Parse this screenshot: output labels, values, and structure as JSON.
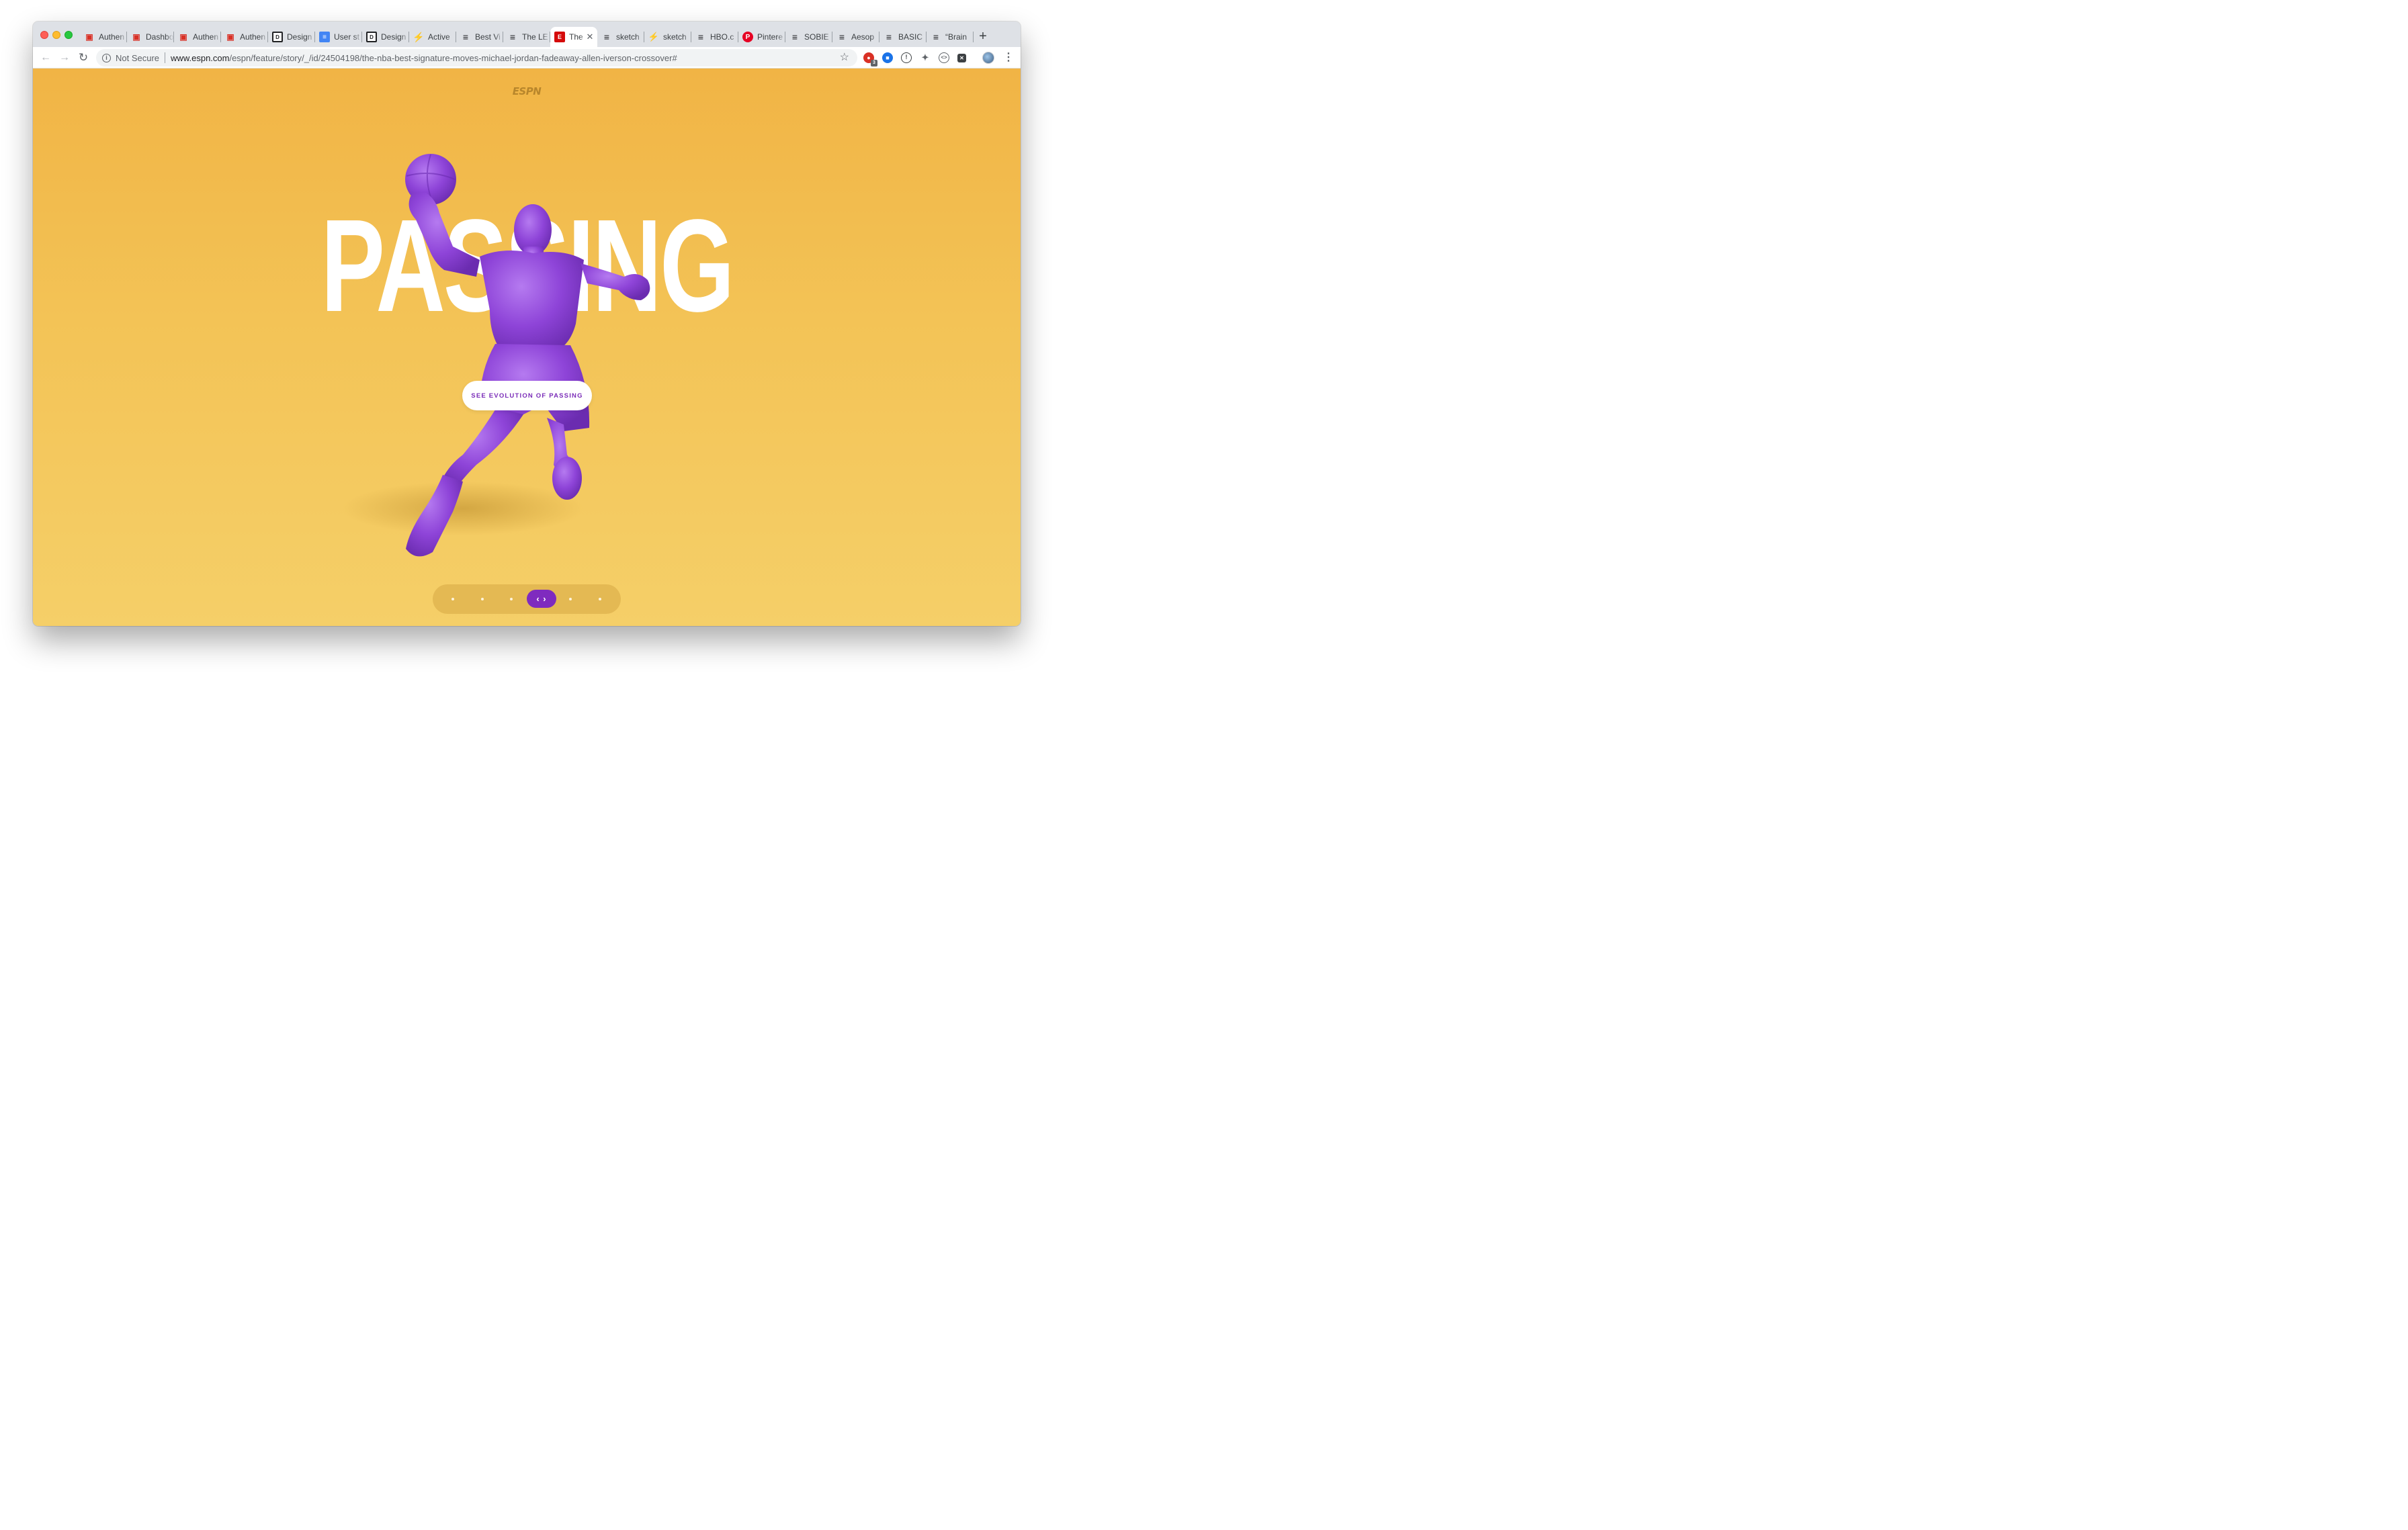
{
  "browser": {
    "tabs": [
      {
        "label": "Authen",
        "icon": "bus-icon",
        "glyph": "▣"
      },
      {
        "label": "Dashbo",
        "icon": "bus-icon",
        "glyph": "▣"
      },
      {
        "label": "Authen",
        "icon": "bus-icon",
        "glyph": "▣"
      },
      {
        "label": "Authen",
        "icon": "bus-icon",
        "glyph": "▣"
      },
      {
        "label": "Design",
        "icon": "design-icon",
        "glyph": "D"
      },
      {
        "label": "User st",
        "icon": "docs-icon",
        "glyph": "≡"
      },
      {
        "label": "Design",
        "icon": "design-icon",
        "glyph": "D"
      },
      {
        "label": "Active",
        "icon": "active-icon",
        "glyph": "⚡"
      },
      {
        "label": "Best Vi",
        "icon": "stack-icon",
        "glyph": "≡"
      },
      {
        "label": "The LE",
        "icon": "stack-icon",
        "glyph": "≡"
      },
      {
        "label": "The",
        "icon": "espn-icon",
        "glyph": "E",
        "active": true
      },
      {
        "label": "sketch",
        "icon": "stack-icon",
        "glyph": "≡"
      },
      {
        "label": "sketch",
        "icon": "sketch-icon",
        "glyph": "⚡"
      },
      {
        "label": "HBO.c",
        "icon": "stack-icon",
        "glyph": "≡"
      },
      {
        "label": "Pintere",
        "icon": "pinterest-icon",
        "glyph": "P"
      },
      {
        "label": "SOBIE",
        "icon": "stack-icon",
        "glyph": "≡"
      },
      {
        "label": "Aesop",
        "icon": "stack-icon",
        "glyph": "≡"
      },
      {
        "label": "BASIC",
        "icon": "stack-icon",
        "glyph": "≡"
      },
      {
        "label": "“Brain",
        "icon": "stack-icon",
        "glyph": "≡"
      }
    ],
    "active_tab_close": "✕",
    "new_tab": "+",
    "security_label": "Not Secure",
    "url_host": "www.espn.com",
    "url_path": "/espn/feature/story/_/id/24504198/the-nba-best-signature-moves-michael-jordan-fadeaway-allen-iverson-crossover#",
    "extension_badge": "3"
  },
  "page": {
    "logo": "ESPN",
    "headline": "PASSING",
    "cta_label": "SEE EVOLUTION OF PASSING",
    "pager": {
      "total": 6,
      "active_index": 3,
      "active_glyph": "‹ ›"
    },
    "colors": {
      "background_top": "#f1b445",
      "background_bottom": "#f5cf68",
      "player": "#8e44d8",
      "accent": "#7f2bbf"
    }
  }
}
